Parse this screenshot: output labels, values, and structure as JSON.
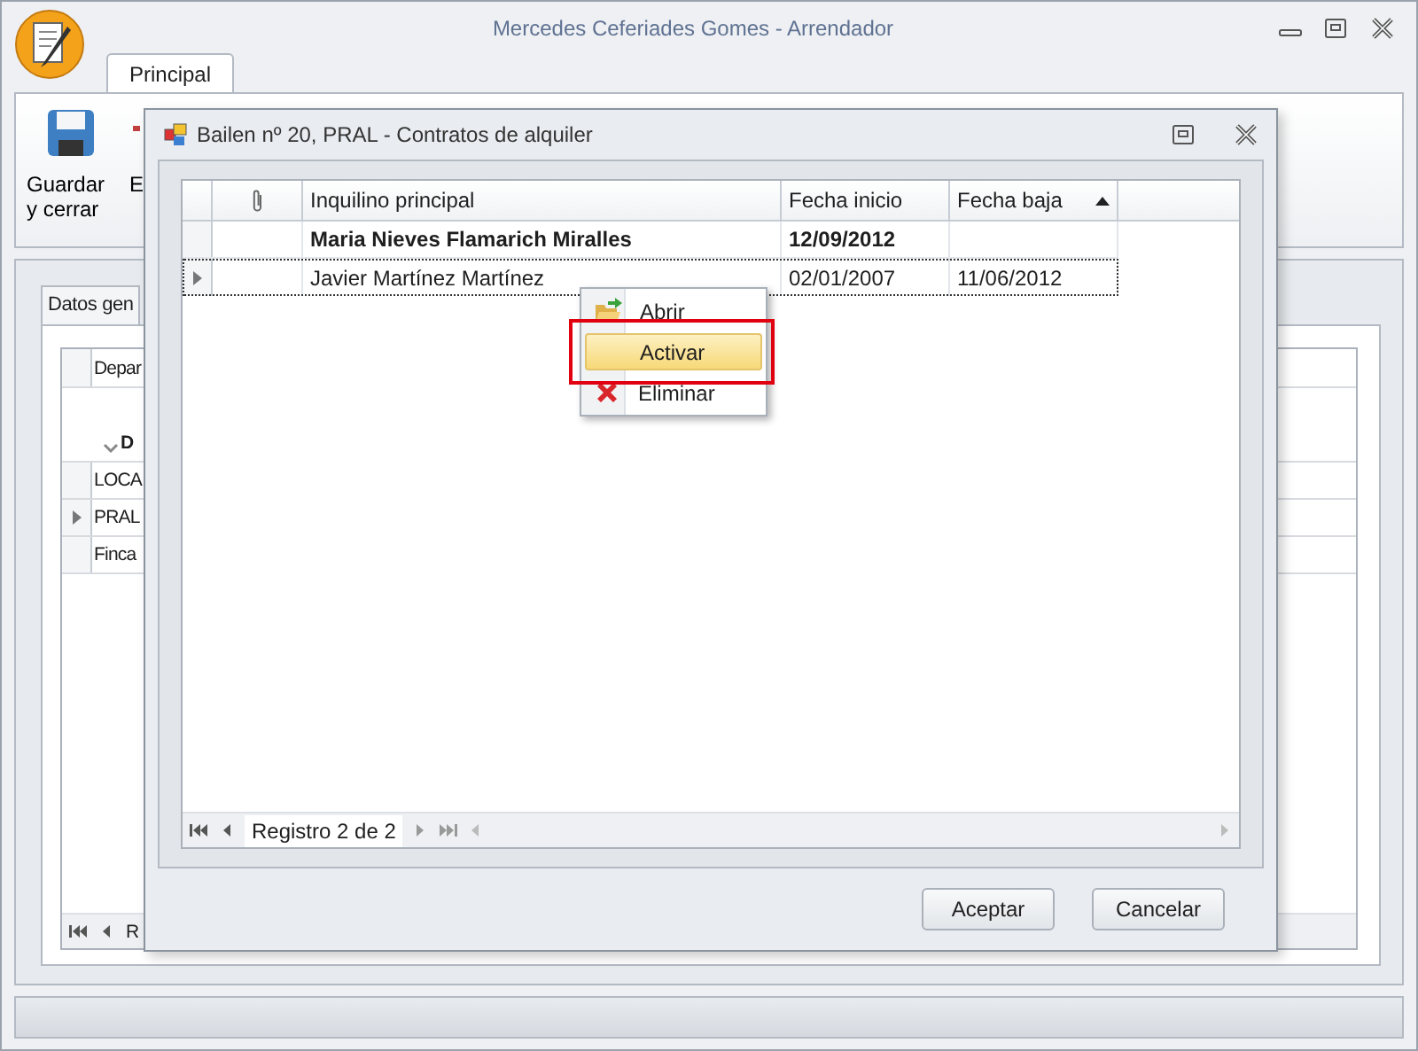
{
  "app": {
    "title": "Mercedes Ceferiades Gomes - Arrendador"
  },
  "ribbon": {
    "tabs": [
      {
        "label": "Principal",
        "selected": true
      }
    ],
    "buttons": [
      {
        "label": "Guardar y cerrar",
        "kind": "save"
      },
      {
        "label": "E",
        "kind": "cut"
      }
    ]
  },
  "main": {
    "tabs": [
      {
        "label": "Datos gen",
        "selected": true
      }
    ],
    "grid": {
      "column": "Depar",
      "group": "D",
      "rows": [
        {
          "text": "LOCA",
          "selected": false
        },
        {
          "text": "PRAL",
          "selected": true
        },
        {
          "text": "Finca",
          "selected": false
        }
      ]
    },
    "navigator": "R"
  },
  "dialog": {
    "title": "Bailen nº 20, PRAL - Contratos de alquiler",
    "columns": [
      {
        "label": "Inquilino principal",
        "sorted": false
      },
      {
        "label": "Fecha inicio",
        "sorted": false
      },
      {
        "label": "Fecha baja",
        "sorted": true
      }
    ],
    "rows": [
      {
        "cells": [
          "Maria Nieves Flamarich Miralles",
          "12/09/2012",
          ""
        ],
        "bold": true,
        "selected": false
      },
      {
        "cells": [
          "Javier Martínez Martínez",
          "02/01/2007",
          "11/06/2012"
        ],
        "bold": false,
        "selected": true
      }
    ],
    "navigator": "Registro 2 de 2",
    "buttons": [
      "Aceptar",
      "Cancelar"
    ]
  },
  "context_menu": {
    "items": [
      {
        "label": "Abrir",
        "kind": "open",
        "hovered": false,
        "outlined": false
      },
      {
        "label": "Activar",
        "kind": "plain",
        "hovered": true,
        "outlined": true
      },
      {
        "label": "Eliminar",
        "kind": "delete",
        "hovered": false,
        "outlined": false
      }
    ]
  }
}
